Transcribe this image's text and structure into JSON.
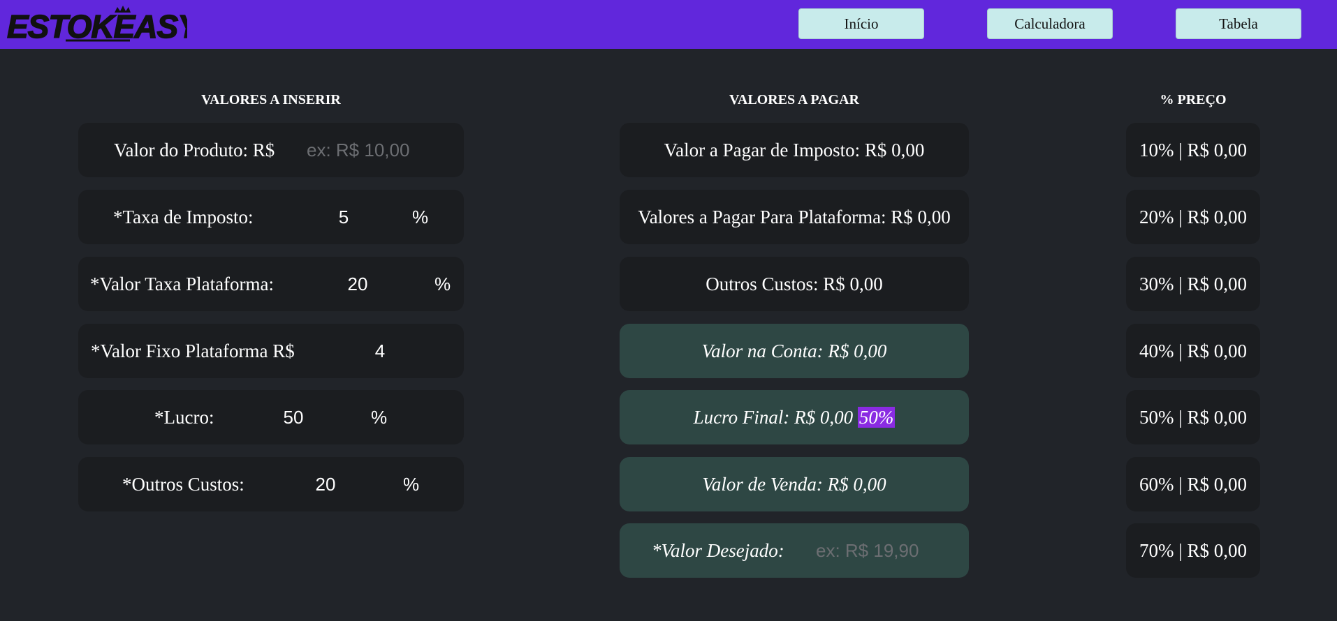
{
  "nav": {
    "logo_text": "ESTOKEASY",
    "buttons": [
      "Início",
      "Calculadora",
      "Tabela"
    ]
  },
  "colors": {
    "navbar": "#6127dc",
    "background": "#212429",
    "card": "#1b1d20",
    "card_highlight": "#2e4744",
    "nav_button": "#c8ebeb",
    "percent_badge": "#8a2be2"
  },
  "inputs": {
    "heading": "VALORES A INSERIR",
    "produto_label": "Valor do Produto: R$",
    "produto_placeholder": "ex: R$ 10,00",
    "imposto_label": "*Taxa de Imposto:",
    "imposto_value": "5",
    "imposto_unit": "%",
    "taxa_plat_label": "*Valor Taxa Plataforma:",
    "taxa_plat_value": "20",
    "taxa_plat_unit": "%",
    "fixo_label": "*Valor Fixo Plataforma R$",
    "fixo_value": "4",
    "lucro_label": "*Lucro:",
    "lucro_value": "50",
    "lucro_unit": "%",
    "outros_label": "*Outros Custos:",
    "outros_value": "20",
    "outros_unit": "%"
  },
  "results": {
    "heading": "VALORES A PAGAR",
    "imposto": "Valor a Pagar de Imposto: R$ 0,00",
    "plataforma": "Valores a Pagar Para Plataforma: R$ 0,00",
    "outros": "Outros Custos: R$ 0,00",
    "conta": "Valor na Conta: R$ 0,00",
    "lucro_final": "Lucro Final: R$ 0,00",
    "lucro_pct": "50%",
    "venda": "Valor de Venda: R$ 0,00",
    "desejado_label": "*Valor Desejado:",
    "desejado_placeholder": "ex: R$ 19,90"
  },
  "prices": {
    "heading": "% PREÇO",
    "rows": [
      "10% | R$ 0,00",
      "20% | R$ 0,00",
      "30% | R$ 0,00",
      "40% | R$ 0,00",
      "50% | R$ 0,00",
      "60% | R$ 0,00",
      "70% | R$ 0,00"
    ]
  }
}
